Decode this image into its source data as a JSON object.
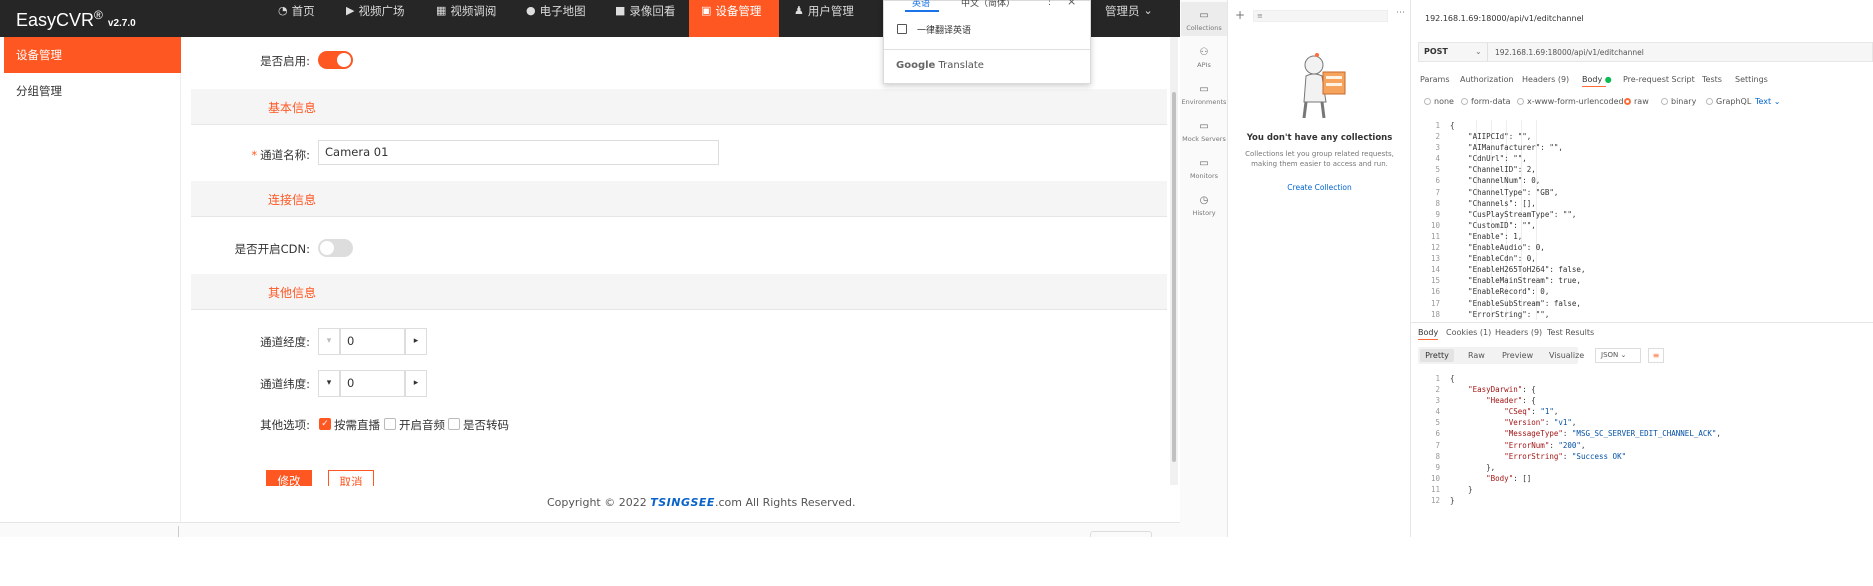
{
  "app": {
    "name": "EasyCVR",
    "registered": "®",
    "version": "v2.7.0",
    "accent": "#ff5722",
    "nav": [
      {
        "label": "首页",
        "icon": "dashboard-icon"
      },
      {
        "label": "视频广场",
        "icon": "play-circle-icon"
      },
      {
        "label": "视频调阅",
        "icon": "grid-icon"
      },
      {
        "label": "电子地图",
        "icon": "map-pin-icon"
      },
      {
        "label": "录像回看",
        "icon": "video-camera-icon"
      },
      {
        "label": "设备管理",
        "icon": "device-icon"
      },
      {
        "label": "用户管理",
        "icon": "user-icon"
      },
      {
        "label": "管理员",
        "icon": "chevron-down-icon"
      }
    ],
    "sidebar": [
      "设备管理",
      "分组管理"
    ]
  },
  "form": {
    "enable_label": "是否启用:",
    "section_basic": "基本信息",
    "channel_name_label": "通道名称:",
    "channel_name_value": "Camera 01",
    "section_connect": "连接信息",
    "cdn_label": "是否开启CDN:",
    "section_other": "其他信息",
    "longitude_label": "通道经度:",
    "longitude_value": "0",
    "latitude_label": "通道纬度:",
    "latitude_value": "0",
    "options_label": "其他选项:",
    "options": [
      {
        "label": "按需直播",
        "checked": true
      },
      {
        "label": "开启音频",
        "checked": false
      },
      {
        "label": "是否转码",
        "checked": false
      }
    ],
    "submit": "修改",
    "cancel": "取消"
  },
  "footer": {
    "copyright_prefix": "Copyright © 2022 ",
    "brand": "TSINGSEE",
    "copyright_suffix": ".com All Rights Reserved."
  },
  "translate_popup": {
    "tab1": "英语",
    "tab2": "中文（简体）",
    "always_translate": "一律翻译英语",
    "brand_google": "Google",
    "brand_translate": "Translate"
  },
  "postman": {
    "sidebar": [
      {
        "label": "Collections",
        "icon": "collections-icon"
      },
      {
        "label": "APIs",
        "icon": "apis-icon"
      },
      {
        "label": "Environments",
        "icon": "environments-icon"
      },
      {
        "label": "Mock Servers",
        "icon": "mock-servers-icon"
      },
      {
        "label": "Monitors",
        "icon": "monitors-icon"
      },
      {
        "label": "History",
        "icon": "history-icon"
      }
    ],
    "empty_title": "You don't have any collections",
    "empty_desc1": "Collections let you group related requests,",
    "empty_desc2": "making them easier to access and run.",
    "create_collection": "Create Collection",
    "request_title": "192.168.1.69:18000/api/v1/editchannel",
    "method": "POST",
    "url": "192.168.1.69:18000/api/v1/editchannel",
    "req_tabs": [
      "Params",
      "Authorization",
      "Headers (9)",
      "Body",
      "Pre-request Script",
      "Tests",
      "Settings"
    ],
    "body_types": [
      "none",
      "form-data",
      "x-www-form-urlencoded",
      "raw",
      "binary",
      "GraphQL"
    ],
    "body_format": "Text",
    "request_body": [
      "{",
      "    \"AIIPCId\": \"\",",
      "    \"AIManufacturer\": \"\",",
      "    \"CdnUrl\": \"\",",
      "    \"ChannelID\": 2,",
      "    \"ChannelNum\": 0,",
      "    \"ChannelType\": \"GB\",",
      "    \"Channels\": [],",
      "    \"CusPlayStreamType\": \"\",",
      "    \"CustomID\": \"\",",
      "    \"Enable\": 1,",
      "    \"EnableAudio\": 0,",
      "    \"EnableCdn\": 0,",
      "    \"EnableH265ToH264\": false,",
      "    \"EnableMainStream\": true,",
      "    \"EnableRecord\": 0,",
      "    \"EnableSubStream\": false,",
      "    \"ErrorString\": \"\","
    ],
    "resp_tabs": [
      "Body",
      "Cookies (1)",
      "Headers (9)",
      "Test Results"
    ],
    "resp_views": [
      "Pretty",
      "Raw",
      "Preview",
      "Visualize"
    ],
    "resp_format": "JSON",
    "response_body": [
      "{",
      "    \"EasyDarwin\": {",
      "        \"Header\": {",
      "            \"CSeq\": \"1\",",
      "            \"Version\": \"v1\",",
      "            \"MessageType\": \"MSG_SC_SERVER_EDIT_CHANNEL_ACK\",",
      "            \"ErrorNum\": \"200\",",
      "            \"ErrorString\": \"Success OK\"",
      "        },",
      "        \"Body\": []",
      "    }",
      "}"
    ],
    "accent": "#ff6c37"
  }
}
